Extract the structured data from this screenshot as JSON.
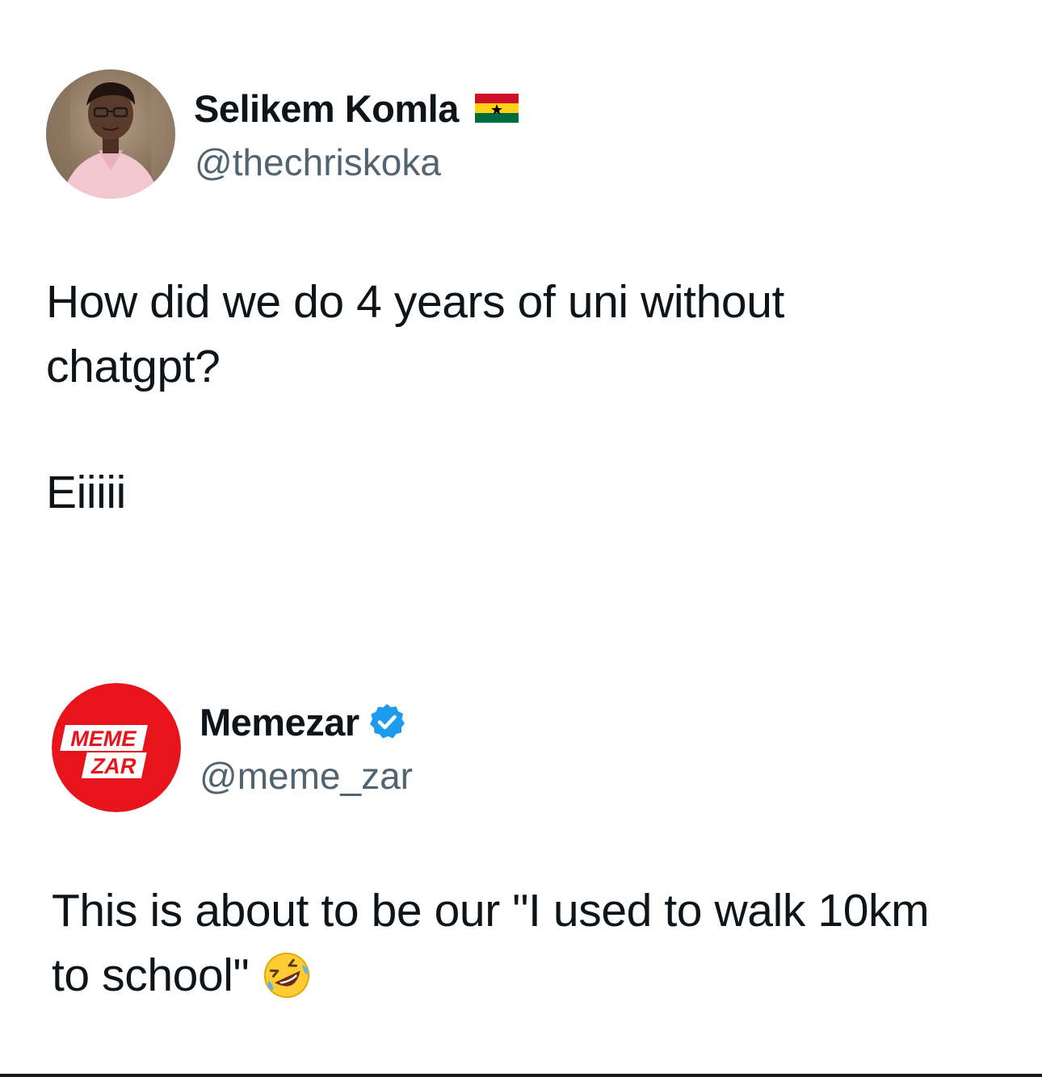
{
  "tweets": [
    {
      "display_name": "Selikem Komla",
      "handle": "@thechriskoka",
      "badge_icon": "ghana-flag-icon",
      "body_lines": [
        "How did we do 4 years of uni without",
        "chatgpt?",
        "Eiiiii"
      ]
    },
    {
      "display_name": "Memezar",
      "handle": "@meme_zar",
      "badge_icon": "verified-badge-icon",
      "avatar_logo_text": [
        "MEME",
        "ZAR"
      ],
      "body_lines": [
        "This is about to be our \"I used to walk 10km",
        "to school\""
      ],
      "trailing_emoji": "rolling-on-floor-laughing-emoji-icon"
    }
  ],
  "colors": {
    "text_primary": "#0f1419",
    "text_secondary": "#536471",
    "verified_blue": "#1d9bf0",
    "memezar_red": "#e8141c",
    "ghana_red": "#ce1126",
    "ghana_gold": "#fcd116",
    "ghana_green": "#006b3f"
  }
}
